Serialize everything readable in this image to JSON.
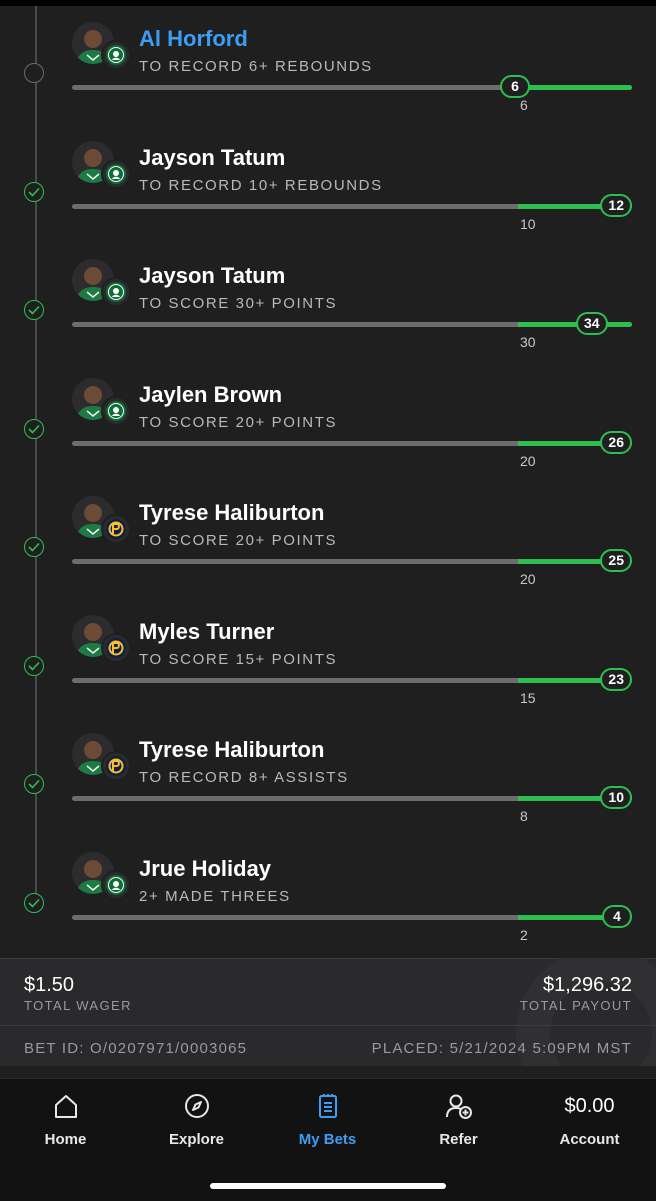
{
  "colors": {
    "accent": "#3d9df3",
    "success": "#2dbf4f",
    "track": "#6d6d71",
    "background": "#1f1f20"
  },
  "legs": [
    {
      "player": "Al Horford",
      "prop": "TO RECORD 6+ REBOUNDS",
      "threshold": "6",
      "current": "6",
      "status": "live",
      "team": "celtics",
      "progress_pct": 80
    },
    {
      "player": "Jayson Tatum",
      "prop": "TO RECORD 10+ REBOUNDS",
      "threshold": "10",
      "current": "12",
      "status": "won",
      "team": "celtics",
      "progress_pct": 100
    },
    {
      "player": "Jayson Tatum",
      "prop": "TO SCORE 30+ POINTS",
      "threshold": "30",
      "current": "34",
      "status": "won",
      "team": "celtics",
      "progress_pct": 100
    },
    {
      "player": "Jaylen Brown",
      "prop": "TO SCORE 20+ POINTS",
      "threshold": "20",
      "current": "26",
      "status": "won",
      "team": "celtics",
      "progress_pct": 100
    },
    {
      "player": "Tyrese Haliburton",
      "prop": "TO SCORE 20+ POINTS",
      "threshold": "20",
      "current": "25",
      "status": "won",
      "team": "pacers",
      "progress_pct": 100
    },
    {
      "player": "Myles Turner",
      "prop": "TO SCORE 15+ POINTS",
      "threshold": "15",
      "current": "23",
      "status": "won",
      "team": "pacers",
      "progress_pct": 100
    },
    {
      "player": "Tyrese Haliburton",
      "prop": "TO RECORD 8+ ASSISTS",
      "threshold": "8",
      "current": "10",
      "status": "won",
      "team": "pacers",
      "progress_pct": 100
    },
    {
      "player": "Jrue Holiday",
      "prop": "2+ MADE THREES",
      "threshold": "2",
      "current": "4",
      "status": "won",
      "team": "celtics",
      "progress_pct": 100
    }
  ],
  "summary": {
    "wager": "$1.50",
    "wager_label": "TOTAL WAGER",
    "payout": "$1,296.32",
    "payout_label": "TOTAL PAYOUT",
    "bet_id": "BET ID: O/0207971/0003065",
    "placed": "PLACED: 5/21/2024 5:09PM MST"
  },
  "nav": {
    "home": "Home",
    "explore": "Explore",
    "mybets": "My Bets",
    "refer": "Refer",
    "balance": "$0.00",
    "account": "Account",
    "active": "mybets"
  }
}
